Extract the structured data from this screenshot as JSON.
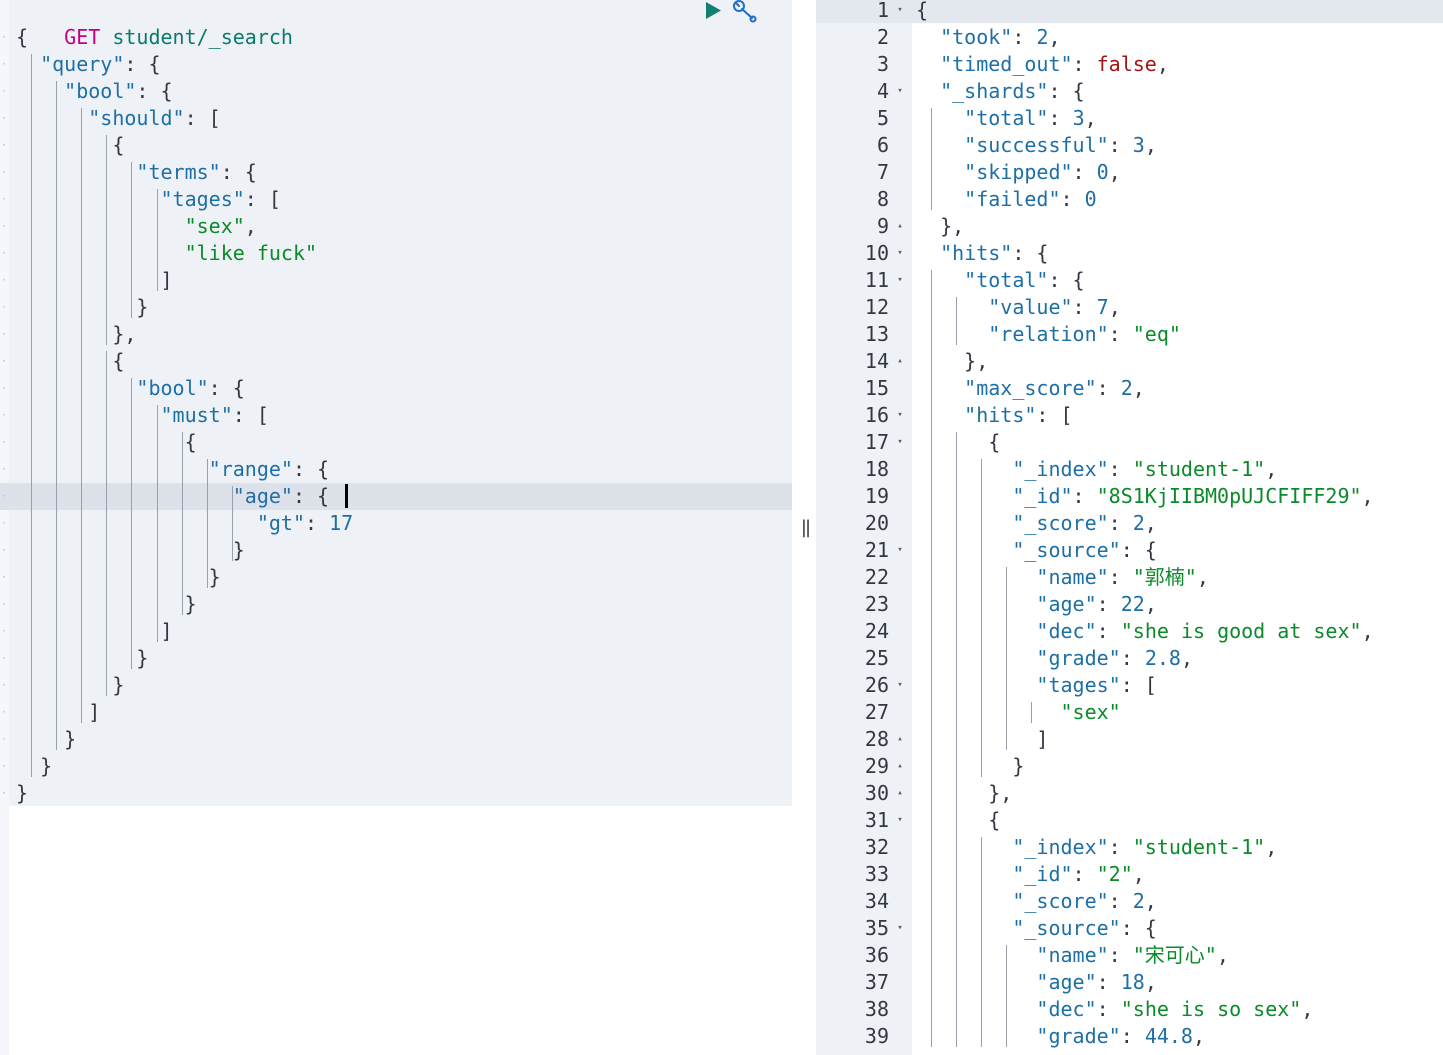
{
  "request": {
    "method": "GET",
    "path": "student/_search",
    "run_icon": "play-icon",
    "settings_icon": "wrench-icon",
    "lines": [
      [
        [
          "p",
          "{"
        ]
      ],
      [
        [
          "p",
          "  "
        ],
        [
          "key",
          "\"query\""
        ],
        [
          "p",
          ": {"
        ]
      ],
      [
        [
          "p",
          "    "
        ],
        [
          "key",
          "\"bool\""
        ],
        [
          "p",
          ": {"
        ]
      ],
      [
        [
          "p",
          "      "
        ],
        [
          "key",
          "\"should\""
        ],
        [
          "p",
          ": ["
        ]
      ],
      [
        [
          "p",
          "        {"
        ]
      ],
      [
        [
          "p",
          "          "
        ],
        [
          "key",
          "\"terms\""
        ],
        [
          "p",
          ": {"
        ]
      ],
      [
        [
          "p",
          "            "
        ],
        [
          "key",
          "\"tages\""
        ],
        [
          "p",
          ": ["
        ]
      ],
      [
        [
          "p",
          "              "
        ],
        [
          "str",
          "\"sex\""
        ],
        [
          "p",
          ","
        ]
      ],
      [
        [
          "p",
          "              "
        ],
        [
          "str",
          "\"like fuck\""
        ]
      ],
      [
        [
          "p",
          "            ]"
        ]
      ],
      [
        [
          "p",
          "          }"
        ]
      ],
      [
        [
          "p",
          "        },"
        ]
      ],
      [
        [
          "p",
          "        {"
        ]
      ],
      [
        [
          "p",
          "          "
        ],
        [
          "key",
          "\"bool\""
        ],
        [
          "p",
          ": {"
        ]
      ],
      [
        [
          "p",
          "            "
        ],
        [
          "key",
          "\"must\""
        ],
        [
          "p",
          ": ["
        ]
      ],
      [
        [
          "p",
          "              {"
        ]
      ],
      [
        [
          "p",
          "                "
        ],
        [
          "key",
          "\"range\""
        ],
        [
          "p",
          ": {"
        ]
      ],
      [
        [
          "p",
          "                  "
        ],
        [
          "key",
          "\"age\""
        ],
        [
          "p",
          ": {"
        ]
      ],
      [
        [
          "p",
          "                    "
        ],
        [
          "key",
          "\"gt\""
        ],
        [
          "p",
          ": "
        ],
        [
          "num",
          "17"
        ]
      ],
      [
        [
          "p",
          "                  }"
        ]
      ],
      [
        [
          "p",
          "                }"
        ]
      ],
      [
        [
          "p",
          "              }"
        ]
      ],
      [
        [
          "p",
          "            ]"
        ]
      ],
      [
        [
          "p",
          "          }"
        ]
      ],
      [
        [
          "p",
          "        }"
        ]
      ],
      [
        [
          "p",
          "      ]"
        ]
      ],
      [
        [
          "p",
          "    }"
        ]
      ],
      [
        [
          "p",
          "  }"
        ]
      ],
      [
        [
          "p",
          "}"
        ]
      ]
    ]
  },
  "divider": {
    "label": "||"
  },
  "response": {
    "lines": [
      {
        "n": "1",
        "fold": "▾",
        "t": [
          [
            "p",
            "{"
          ]
        ]
      },
      {
        "n": "2",
        "fold": "",
        "t": [
          [
            "p",
            "  "
          ],
          [
            "key",
            "\"took\""
          ],
          [
            "p",
            ": "
          ],
          [
            "num",
            "2"
          ],
          [
            "p",
            ","
          ]
        ]
      },
      {
        "n": "3",
        "fold": "",
        "t": [
          [
            "p",
            "  "
          ],
          [
            "key",
            "\"timed_out\""
          ],
          [
            "p",
            ": "
          ],
          [
            "kw",
            "false"
          ],
          [
            "p",
            ","
          ]
        ]
      },
      {
        "n": "4",
        "fold": "▾",
        "t": [
          [
            "p",
            "  "
          ],
          [
            "key",
            "\"_shards\""
          ],
          [
            "p",
            ": {"
          ]
        ]
      },
      {
        "n": "5",
        "fold": "",
        "t": [
          [
            "p",
            "    "
          ],
          [
            "key",
            "\"total\""
          ],
          [
            "p",
            ": "
          ],
          [
            "num",
            "3"
          ],
          [
            "p",
            ","
          ]
        ]
      },
      {
        "n": "6",
        "fold": "",
        "t": [
          [
            "p",
            "    "
          ],
          [
            "key",
            "\"successful\""
          ],
          [
            "p",
            ": "
          ],
          [
            "num",
            "3"
          ],
          [
            "p",
            ","
          ]
        ]
      },
      {
        "n": "7",
        "fold": "",
        "t": [
          [
            "p",
            "    "
          ],
          [
            "key",
            "\"skipped\""
          ],
          [
            "p",
            ": "
          ],
          [
            "num",
            "0"
          ],
          [
            "p",
            ","
          ]
        ]
      },
      {
        "n": "8",
        "fold": "",
        "t": [
          [
            "p",
            "    "
          ],
          [
            "key",
            "\"failed\""
          ],
          [
            "p",
            ": "
          ],
          [
            "num",
            "0"
          ]
        ]
      },
      {
        "n": "9",
        "fold": "▴",
        "t": [
          [
            "p",
            "  },"
          ]
        ]
      },
      {
        "n": "10",
        "fold": "▾",
        "t": [
          [
            "p",
            "  "
          ],
          [
            "key",
            "\"hits\""
          ],
          [
            "p",
            ": {"
          ]
        ]
      },
      {
        "n": "11",
        "fold": "▾",
        "t": [
          [
            "p",
            "    "
          ],
          [
            "key",
            "\"total\""
          ],
          [
            "p",
            ": {"
          ]
        ]
      },
      {
        "n": "12",
        "fold": "",
        "t": [
          [
            "p",
            "      "
          ],
          [
            "key",
            "\"value\""
          ],
          [
            "p",
            ": "
          ],
          [
            "num",
            "7"
          ],
          [
            "p",
            ","
          ]
        ]
      },
      {
        "n": "13",
        "fold": "",
        "t": [
          [
            "p",
            "      "
          ],
          [
            "key",
            "\"relation\""
          ],
          [
            "p",
            ": "
          ],
          [
            "str",
            "\"eq\""
          ]
        ]
      },
      {
        "n": "14",
        "fold": "▴",
        "t": [
          [
            "p",
            "    },"
          ]
        ]
      },
      {
        "n": "15",
        "fold": "",
        "t": [
          [
            "p",
            "    "
          ],
          [
            "key",
            "\"max_score\""
          ],
          [
            "p",
            ": "
          ],
          [
            "num",
            "2"
          ],
          [
            "p",
            ","
          ]
        ]
      },
      {
        "n": "16",
        "fold": "▾",
        "t": [
          [
            "p",
            "    "
          ],
          [
            "key",
            "\"hits\""
          ],
          [
            "p",
            ": ["
          ]
        ]
      },
      {
        "n": "17",
        "fold": "▾",
        "t": [
          [
            "p",
            "      {"
          ]
        ]
      },
      {
        "n": "18",
        "fold": "",
        "t": [
          [
            "p",
            "        "
          ],
          [
            "key",
            "\"_index\""
          ],
          [
            "p",
            ": "
          ],
          [
            "str",
            "\"student-1\""
          ],
          [
            "p",
            ","
          ]
        ]
      },
      {
        "n": "19",
        "fold": "",
        "t": [
          [
            "p",
            "        "
          ],
          [
            "key",
            "\"_id\""
          ],
          [
            "p",
            ": "
          ],
          [
            "str",
            "\"8S1KjIIBM0pUJCFIFF29\""
          ],
          [
            "p",
            ","
          ]
        ]
      },
      {
        "n": "20",
        "fold": "",
        "t": [
          [
            "p",
            "        "
          ],
          [
            "key",
            "\"_score\""
          ],
          [
            "p",
            ": "
          ],
          [
            "num",
            "2"
          ],
          [
            "p",
            ","
          ]
        ]
      },
      {
        "n": "21",
        "fold": "▾",
        "t": [
          [
            "p",
            "        "
          ],
          [
            "key",
            "\"_source\""
          ],
          [
            "p",
            ": {"
          ]
        ]
      },
      {
        "n": "22",
        "fold": "",
        "t": [
          [
            "p",
            "          "
          ],
          [
            "key",
            "\"name\""
          ],
          [
            "p",
            ": "
          ],
          [
            "str",
            "\"郭楠\""
          ],
          [
            "p",
            ","
          ]
        ]
      },
      {
        "n": "23",
        "fold": "",
        "t": [
          [
            "p",
            "          "
          ],
          [
            "key",
            "\"age\""
          ],
          [
            "p",
            ": "
          ],
          [
            "num",
            "22"
          ],
          [
            "p",
            ","
          ]
        ]
      },
      {
        "n": "24",
        "fold": "",
        "t": [
          [
            "p",
            "          "
          ],
          [
            "key",
            "\"dec\""
          ],
          [
            "p",
            ": "
          ],
          [
            "str",
            "\"she is good at sex\""
          ],
          [
            "p",
            ","
          ]
        ]
      },
      {
        "n": "25",
        "fold": "",
        "t": [
          [
            "p",
            "          "
          ],
          [
            "key",
            "\"grade\""
          ],
          [
            "p",
            ": "
          ],
          [
            "num",
            "2.8"
          ],
          [
            "p",
            ","
          ]
        ]
      },
      {
        "n": "26",
        "fold": "▾",
        "t": [
          [
            "p",
            "          "
          ],
          [
            "key",
            "\"tages\""
          ],
          [
            "p",
            ": ["
          ]
        ]
      },
      {
        "n": "27",
        "fold": "",
        "t": [
          [
            "p",
            "            "
          ],
          [
            "str",
            "\"sex\""
          ]
        ]
      },
      {
        "n": "28",
        "fold": "▴",
        "t": [
          [
            "p",
            "          ]"
          ]
        ]
      },
      {
        "n": "29",
        "fold": "▴",
        "t": [
          [
            "p",
            "        }"
          ]
        ]
      },
      {
        "n": "30",
        "fold": "▴",
        "t": [
          [
            "p",
            "      },"
          ]
        ]
      },
      {
        "n": "31",
        "fold": "▾",
        "t": [
          [
            "p",
            "      {"
          ]
        ]
      },
      {
        "n": "32",
        "fold": "",
        "t": [
          [
            "p",
            "        "
          ],
          [
            "key",
            "\"_index\""
          ],
          [
            "p",
            ": "
          ],
          [
            "str",
            "\"student-1\""
          ],
          [
            "p",
            ","
          ]
        ]
      },
      {
        "n": "33",
        "fold": "",
        "t": [
          [
            "p",
            "        "
          ],
          [
            "key",
            "\"_id\""
          ],
          [
            "p",
            ": "
          ],
          [
            "str",
            "\"2\""
          ],
          [
            "p",
            ","
          ]
        ]
      },
      {
        "n": "34",
        "fold": "",
        "t": [
          [
            "p",
            "        "
          ],
          [
            "key",
            "\"_score\""
          ],
          [
            "p",
            ": "
          ],
          [
            "num",
            "2"
          ],
          [
            "p",
            ","
          ]
        ]
      },
      {
        "n": "35",
        "fold": "▾",
        "t": [
          [
            "p",
            "        "
          ],
          [
            "key",
            "\"_source\""
          ],
          [
            "p",
            ": {"
          ]
        ]
      },
      {
        "n": "36",
        "fold": "",
        "t": [
          [
            "p",
            "          "
          ],
          [
            "key",
            "\"name\""
          ],
          [
            "p",
            ": "
          ],
          [
            "str",
            "\"宋可心\""
          ],
          [
            "p",
            ","
          ]
        ]
      },
      {
        "n": "37",
        "fold": "",
        "t": [
          [
            "p",
            "          "
          ],
          [
            "key",
            "\"age\""
          ],
          [
            "p",
            ": "
          ],
          [
            "num",
            "18"
          ],
          [
            "p",
            ","
          ]
        ]
      },
      {
        "n": "38",
        "fold": "",
        "t": [
          [
            "p",
            "          "
          ],
          [
            "key",
            "\"dec\""
          ],
          [
            "p",
            ": "
          ],
          [
            "str",
            "\"she is so sex\""
          ],
          [
            "p",
            ","
          ]
        ]
      },
      {
        "n": "39",
        "fold": "",
        "t": [
          [
            "p",
            "          "
          ],
          [
            "key",
            "\"grade\""
          ],
          [
            "p",
            ": "
          ],
          [
            "num",
            "44.8"
          ],
          [
            "p",
            ","
          ]
        ]
      }
    ]
  }
}
